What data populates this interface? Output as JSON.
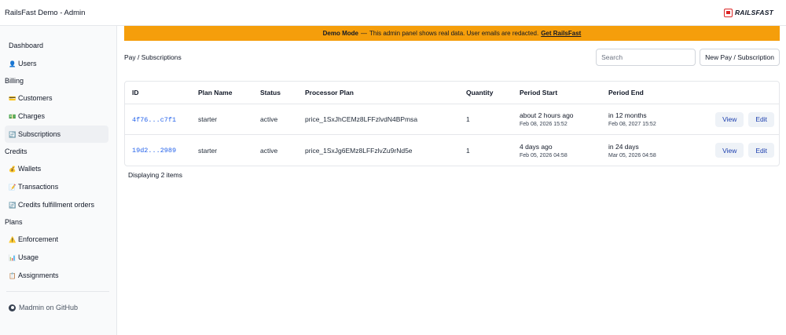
{
  "app": {
    "title": "RailsFast Demo - Admin",
    "logo_text": "RAILSFAST"
  },
  "sidebar": {
    "items": [
      {
        "label": "Dashboard",
        "icon": "",
        "type": "link"
      },
      {
        "label": "Users",
        "icon": "👤",
        "type": "link"
      },
      {
        "label": "Billing",
        "type": "section"
      },
      {
        "label": "Customers",
        "icon": "💳",
        "type": "link"
      },
      {
        "label": "Charges",
        "icon": "💵",
        "type": "link"
      },
      {
        "label": "Subscriptions",
        "icon": "🔄",
        "type": "link",
        "active": true
      },
      {
        "label": "Credits",
        "type": "section"
      },
      {
        "label": "Wallets",
        "icon": "💰",
        "type": "link"
      },
      {
        "label": "Transactions",
        "icon": "📝",
        "type": "link"
      },
      {
        "label": "Credits fulfillment orders",
        "icon": "🔄",
        "type": "link"
      },
      {
        "label": "Plans",
        "type": "section"
      },
      {
        "label": "Enforcement",
        "icon": "⚠️",
        "type": "link"
      },
      {
        "label": "Usage",
        "icon": "📊",
        "type": "link"
      },
      {
        "label": "Assignments",
        "icon": "📋",
        "type": "link"
      }
    ],
    "github_label": "Madmin on GitHub"
  },
  "banner": {
    "mode": "Demo Mode",
    "separator": "—",
    "message": "This admin panel shows real data. User emails are redacted.",
    "link": "Get RailsFast"
  },
  "breadcrumb": "Pay / Subscriptions",
  "search": {
    "placeholder": "Search",
    "value": ""
  },
  "new_button": "New Pay / Subscription",
  "table": {
    "columns": [
      "ID",
      "Plan Name",
      "Status",
      "Processor Plan",
      "Quantity",
      "Period Start",
      "Period End"
    ],
    "rows": [
      {
        "id": "4f76...c7f1",
        "plan": "starter",
        "status": "active",
        "processor_plan": "price_1SxJhCEMz8LFFzlvdN4BPmsa",
        "quantity": "1",
        "period_start_rel": "about 2 hours ago",
        "period_start_abs": "Feb 08, 2026 15:52",
        "period_end_rel": "in 12 months",
        "period_end_abs": "Feb 08, 2027 15:52"
      },
      {
        "id": "19d2...2989",
        "plan": "starter",
        "status": "active",
        "processor_plan": "price_1SxJg6EMz8LFFzlvZu9rNd5e",
        "quantity": "1",
        "period_start_rel": "4 days ago",
        "period_start_abs": "Feb 05, 2026 04:58",
        "period_end_rel": "in 24 days",
        "period_end_abs": "Mar 05, 2026 04:58"
      }
    ],
    "view_label": "View",
    "edit_label": "Edit"
  },
  "footer_note": "Displaying 2 items",
  "colors": {
    "banner": "#f59e0b",
    "link": "#2563eb",
    "logo": "#dc2626"
  }
}
